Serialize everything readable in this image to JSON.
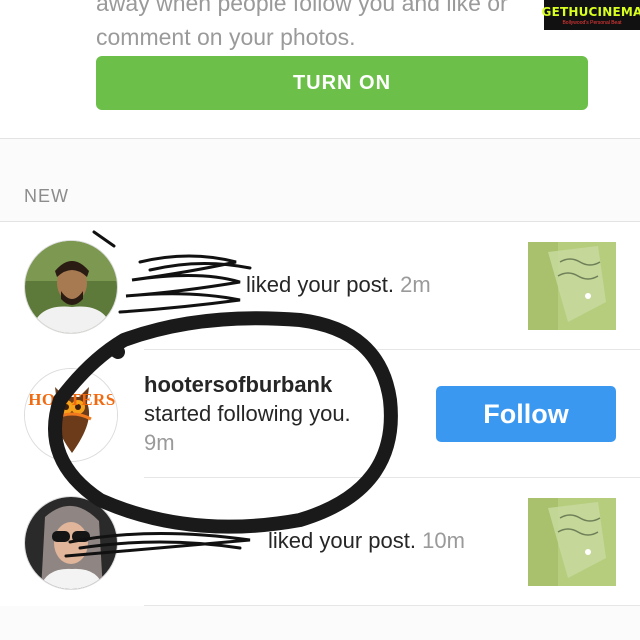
{
  "top": {
    "promo_text": "away when people follow you and like or comment on your photos.",
    "turn_on_label": "TURN ON"
  },
  "watermark": {
    "title": "GETHUCINEMA",
    "subtitle": "Bollywood's Personal Beat"
  },
  "section": {
    "header": "NEW"
  },
  "notifications": [
    {
      "username_obscured": true,
      "action": "liked your post.",
      "time": "2m"
    },
    {
      "username": "hootersofburbank",
      "action": "started following you.",
      "time": "9m",
      "follow_label": "Follow",
      "avatar_text": "HOOTERS"
    },
    {
      "username_obscured": true,
      "action": "liked your post.",
      "time": "10m"
    }
  ],
  "colors": {
    "green": "#6cc04a",
    "blue": "#3a98f0",
    "gray_text": "#9a9a9a"
  }
}
